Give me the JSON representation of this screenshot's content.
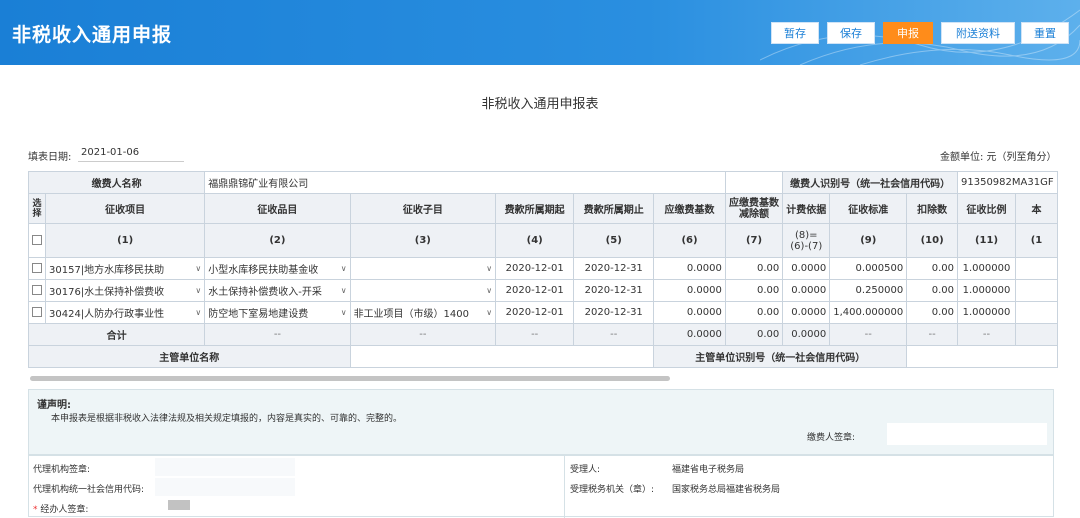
{
  "header": {
    "app_title": "非税收入通用申报",
    "buttons": {
      "save_draft": "暂存",
      "save": "保存",
      "declare": "申报",
      "attach": "附送资料",
      "reset": "重置"
    }
  },
  "form": {
    "title": "非税收入通用申报表",
    "fill_date_label": "填表日期:",
    "fill_date": "2021-01-06",
    "amount_unit": "金额单位: 元（列至角分）",
    "payer_name_label": "缴费人名称",
    "payer_name": "福鼎鼎锦矿业有限公司",
    "payer_id_label": "缴费人识别号（统一社会信用代码）",
    "payer_id": "91350982MA31GF"
  },
  "table": {
    "headers": [
      "选择",
      "征收项目",
      "征收品目",
      "征收子目",
      "费款所属期起",
      "费款所属期止",
      "应缴费基数",
      "应缴费基数减除额",
      "计费依据",
      "征收标准",
      "扣除数",
      "征收比例",
      "本"
    ],
    "index_row": [
      "",
      "(1)",
      "(2)",
      "(3)",
      "(4)",
      "(5)",
      "(6)",
      "(7)",
      "(8)=(6)-(7)",
      "(9)",
      "(10)",
      "(11)",
      "(1"
    ],
    "rows": [
      {
        "item": "30157|地方水库移民扶助",
        "category": "小型水库移民扶助基金收",
        "sub": "",
        "start": "2020-12-01",
        "end": "2020-12-31",
        "base": "0.0000",
        "deduct_base": "0.00",
        "basis": "0.0000",
        "standard": "0.000500",
        "deduction": "0.00",
        "ratio": "1.000000"
      },
      {
        "item": "30176|水土保持补偿费收",
        "category": "水土保持补偿费收入-开采",
        "sub": "",
        "start": "2020-12-01",
        "end": "2020-12-31",
        "base": "0.0000",
        "deduct_base": "0.00",
        "basis": "0.0000",
        "standard": "0.250000",
        "deduction": "0.00",
        "ratio": "1.000000"
      },
      {
        "item": "30424|人防办行政事业性",
        "category": "防空地下室易地建设费",
        "sub": "非工业项目（市级）1400",
        "start": "2020-12-01",
        "end": "2020-12-31",
        "base": "0.0000",
        "deduct_base": "0.00",
        "basis": "0.0000",
        "standard": "1,400.000000",
        "deduction": "0.00",
        "ratio": "1.000000"
      }
    ],
    "total": {
      "label": "合计",
      "dash": "--",
      "base": "0.0000",
      "deduct_base": "0.00",
      "basis": "0.0000"
    },
    "supervisor_name_label": "主管单位名称",
    "supervisor_id_label": "主管单位识别号（统一社会信用代码）"
  },
  "declaration": {
    "title": "谨声明:",
    "body": "本申报表是根据非税收入法律法规及相关规定填报的，内容是真实的、可靠的、完整的。",
    "payer_sign_label": "缴费人签章:"
  },
  "agency": {
    "agent_org_label": "代理机构签章:",
    "agent_code_label": "代理机构统一社会信用代码:",
    "handler_label": "经办人签章:",
    "receiver_label": "受理人:",
    "receiver_value": "福建省电子税务局",
    "tax_office_label": "受理税务机关（章）:",
    "tax_office_value": "国家税务总局福建省税务局"
  }
}
